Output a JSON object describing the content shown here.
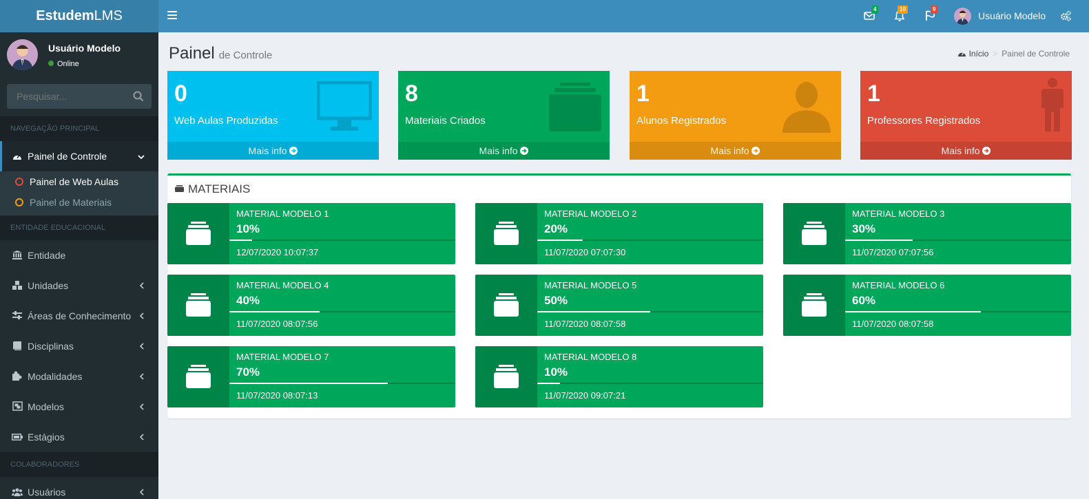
{
  "app": {
    "brand_bold": "Estudem",
    "brand_rest": "LMS"
  },
  "user": {
    "name": "Usuário Modelo",
    "status": "Online"
  },
  "search": {
    "placeholder": "Pesquisar..."
  },
  "sidebar": {
    "section_main": "NAVEGAÇÃO PRINCIPAL",
    "dashboard": {
      "label": "Painel de Controle",
      "icon": "dashboard-icon"
    },
    "sub_items": [
      {
        "label": "Painel de Web Aulas",
        "color": "#dd4b39"
      },
      {
        "label": "Painel de Materiais",
        "color": "#f39c12"
      }
    ],
    "section_entity": "ENTIDADE EDUCACIONAL",
    "items": [
      {
        "label": "Entidade",
        "icon": "bank-icon",
        "chevron": false
      },
      {
        "label": "Unidades",
        "icon": "cubes-icon",
        "chevron": true
      },
      {
        "label": "Áreas de Conhecimento",
        "icon": "sliders-icon",
        "chevron": true
      },
      {
        "label": "Disciplinas",
        "icon": "book-icon",
        "chevron": true
      },
      {
        "label": "Modalidades",
        "icon": "puzzle-icon",
        "chevron": true
      },
      {
        "label": "Modelos",
        "icon": "object-group-icon",
        "chevron": true
      },
      {
        "label": "Estágios",
        "icon": "battery-icon",
        "chevron": true
      }
    ],
    "section_collab": "COLABORADORES",
    "collab_items": [
      {
        "label": "Usuários",
        "icon": "users-icon",
        "chevron": true
      }
    ]
  },
  "navbar": {
    "messages_count": "4",
    "notifications_count": "10",
    "tasks_count": "9",
    "user_name": "Usuário Modelo"
  },
  "page": {
    "title": "Painel",
    "subtitle": "de Controle",
    "breadcrumb_home": "Início",
    "breadcrumb_current": "Painel de Controle"
  },
  "stats": [
    {
      "number": "0",
      "label": "Web Aulas Produzidas",
      "more": "Mais info",
      "color": "#00c0ef",
      "icon": "desktop-icon"
    },
    {
      "number": "8",
      "label": "Materiais Criados",
      "more": "Mais info",
      "color": "#00a65a",
      "icon": "archive-icon"
    },
    {
      "number": "1",
      "label": "Alunos Registrados",
      "more": "Mais info",
      "color": "#f39c12",
      "icon": "user-icon"
    },
    {
      "number": "1",
      "label": "Professores Registrados",
      "more": "Mais info",
      "color": "#dd4b39",
      "icon": "male-icon"
    }
  ],
  "materials": {
    "title": "MATERIAIS",
    "items": [
      {
        "name": "MATERIAL MODELO 1",
        "percent": "10%",
        "progress": 10,
        "date": "12/07/2020 10:07:37"
      },
      {
        "name": "MATERIAL MODELO 2",
        "percent": "20%",
        "progress": 20,
        "date": "11/07/2020 07:07:30"
      },
      {
        "name": "MATERIAL MODELO 3",
        "percent": "30%",
        "progress": 30,
        "date": "11/07/2020 07:07:56"
      },
      {
        "name": "MATERIAL MODELO 4",
        "percent": "40%",
        "progress": 40,
        "date": "11/07/2020 08:07:56"
      },
      {
        "name": "MATERIAL MODELO 5",
        "percent": "50%",
        "progress": 50,
        "date": "11/07/2020 08:07:58"
      },
      {
        "name": "MATERIAL MODELO 6",
        "percent": "60%",
        "progress": 60,
        "date": "11/07/2020 08:07:58"
      },
      {
        "name": "MATERIAL MODELO 7",
        "percent": "70%",
        "progress": 70,
        "date": "11/07/2020 08:07:13"
      },
      {
        "name": "MATERIAL MODELO 8",
        "percent": "10%",
        "progress": 10,
        "date": "11/07/2020 09:07:21"
      }
    ]
  }
}
